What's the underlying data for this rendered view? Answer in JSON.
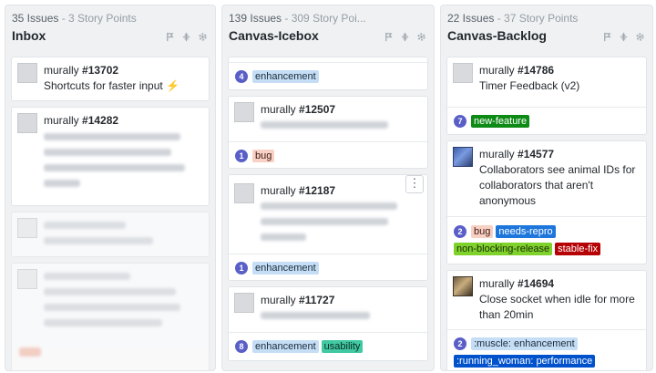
{
  "columns": [
    {
      "issues": "35 Issues",
      "points": " - 3 Story Points",
      "title": "Inbox",
      "cards": [
        {
          "author": "murally",
          "number": "#13702",
          "title": "Shortcuts for faster input ⚡"
        },
        {
          "author": "murally",
          "number": "#14282"
        }
      ]
    },
    {
      "issues": "139 Issues",
      "points": " - 309 Story Poi...",
      "title": "Canvas-Icebox",
      "cards": [
        {
          "points": "4",
          "labels": [
            "enhancement"
          ]
        },
        {
          "author": "murally",
          "number": "#12507",
          "points": "1",
          "labels": [
            "bug"
          ]
        },
        {
          "author": "murally",
          "number": "#12187",
          "points": "1",
          "labels": [
            "enhancement"
          ],
          "menu": "⋮"
        },
        {
          "author": "murally",
          "number": "#11727",
          "points": "8",
          "labels": [
            "enhancement",
            "usability"
          ]
        }
      ]
    },
    {
      "issues": "22 Issues",
      "points": " - 37 Story Points",
      "title": "Canvas-Backlog",
      "cards": [
        {
          "author": "murally",
          "number": "#14786",
          "title": "Timer Feedback (v2)",
          "points": "7",
          "labels": [
            "new-feature"
          ]
        },
        {
          "author": "murally",
          "number": "#14577",
          "title": "Collaborators see animal IDs for collaborators that aren't anonymous",
          "points": "2",
          "labels": [
            "bug",
            "needs-repro",
            "non-blocking-release",
            "stable-fix"
          ]
        },
        {
          "author": "murally",
          "number": "#14694",
          "title": "Close socket when idle for more than 20min",
          "points": "2",
          "labels": [
            ":muscle: enhancement",
            ":running_woman: performance"
          ]
        }
      ]
    }
  ],
  "colors": {
    "enhancement": "#c5def5",
    "bug": "#f9d0c4",
    "new-feature": "#0e8a16",
    "needs-repro": "#1d76db",
    "non-blocking-release": "#7fd12c",
    "stable-fix": "#b60205",
    "usability": "#40c9a2",
    "performance": "#0052cc",
    "points_badge": "#5a5fc8"
  }
}
